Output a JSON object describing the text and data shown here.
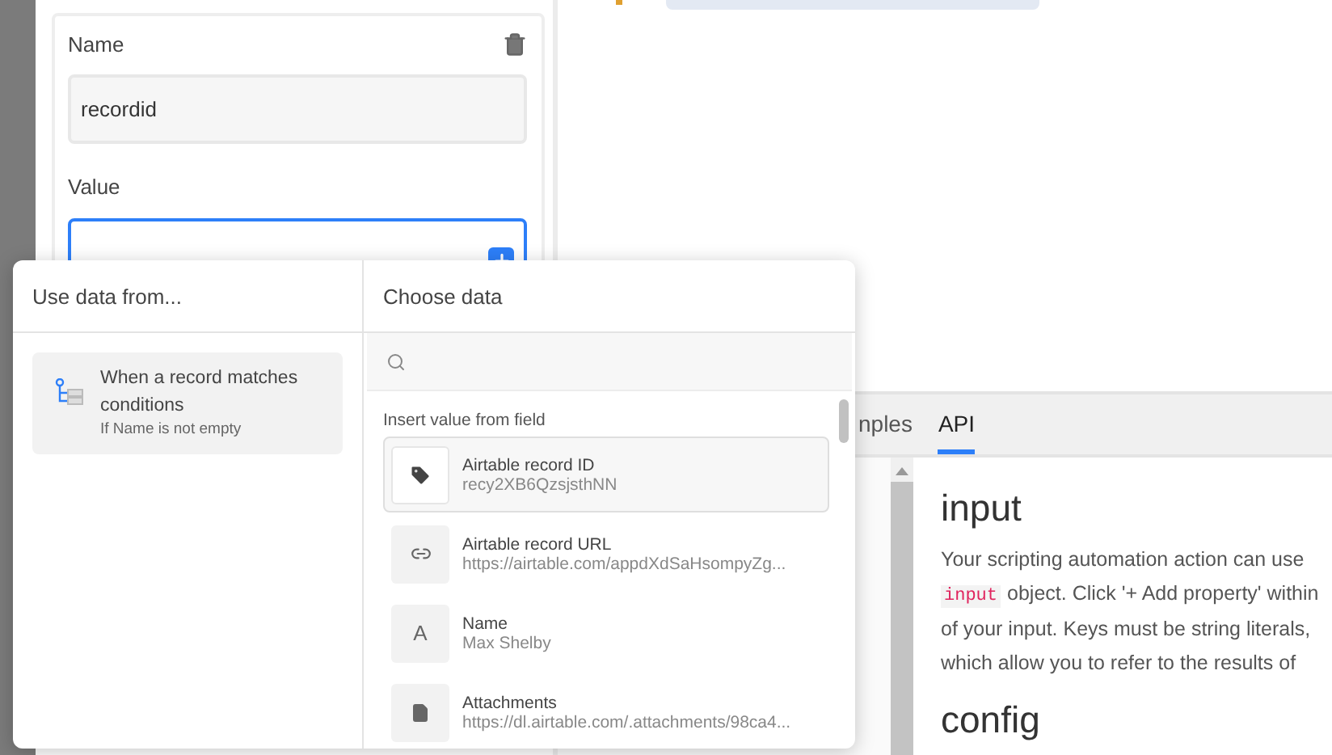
{
  "property_card": {
    "name_label": "Name",
    "name_value": "recordid",
    "value_label": "Value",
    "focused": true
  },
  "popup": {
    "source_header": "Use data from...",
    "sources": [
      {
        "title": "When a record matches conditions",
        "subtitle": "If Name is not empty",
        "selected": true
      }
    ],
    "choose_header": "Choose data",
    "section_label": "Insert value from field",
    "fields": [
      {
        "kind": "id",
        "title": "Airtable record ID",
        "value": "recy2XB6QzsjsthNN",
        "selected": true
      },
      {
        "kind": "url",
        "title": "Airtable record URL",
        "value": "https://airtable.com/appdXdSaHsompyZg...",
        "selected": false
      },
      {
        "kind": "text",
        "icon_char": "A",
        "title": "Name",
        "value": "Max Shelby",
        "selected": false
      },
      {
        "kind": "attachment",
        "title": "Attachments",
        "value": "https://dl.airtable.com/.attachments/98ca4...",
        "selected": false
      }
    ]
  },
  "tabs": [
    {
      "label": "nples",
      "selected": false
    },
    {
      "label": "API",
      "selected": true
    }
  ],
  "api_doc": {
    "heading": "input",
    "lines": [
      {
        "text": "Your scripting automation action can use"
      },
      {
        "code": "input",
        "text": "object. Click '+ Add property' within"
      },
      {
        "text": "of your input. Keys must be string literals,"
      },
      {
        "text": "which allow you to refer to the results of"
      }
    ],
    "heading_2": "config"
  }
}
